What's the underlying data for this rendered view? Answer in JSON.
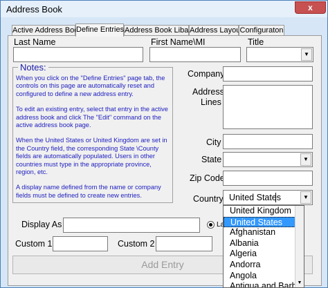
{
  "window": {
    "title": "Address Book",
    "close_label": "x"
  },
  "tabs": [
    {
      "label": "Active Address Book"
    },
    {
      "label": "Define Entries"
    },
    {
      "label": "Address Book Libary"
    },
    {
      "label": "Address Layout"
    },
    {
      "label": "Configuraton"
    }
  ],
  "labels": {
    "last_name": "Last Name",
    "first_name": "First Name\\MI",
    "title": "Title",
    "company": "Company",
    "address": "Address",
    "lines": "Lines",
    "city": "City",
    "state": "State",
    "zip": "Zip Code",
    "country": "Country",
    "display_as": "Display As",
    "custom1": "Custom 1",
    "custom2": "Custom 2",
    "radio_partial": "La"
  },
  "fields": {
    "country_value": "United States"
  },
  "notes": {
    "title": "Notes:",
    "p1": "When you click on the \"Define Entries\" page tab, the controls on this page are automatically reset and configured to define a new address entry.",
    "p2": "To edit an existing entry, select that entry in the active address book and click The \"Edit\" command on the active address book page.",
    "p3": "When the United States or United Kingdom are set in the Country field, the corresponding State \\County fields are automatically populated. Users in other countries must type in the appropriate province, region, etc.",
    "p4": "A display name defined from the name or company fields must be defined to create new entries."
  },
  "country_options": [
    "United Kingdom",
    "United States",
    "Afghanistan",
    "Albania",
    "Algeria",
    "Andorra",
    "Angola",
    "Antigua and Barbuda"
  ],
  "selected_country_index": 1,
  "buttons": {
    "add_entry": "Add Entry"
  },
  "colors": {
    "selected": "#3399ff",
    "notes_text": "#2020c0",
    "close": "#c75050"
  }
}
